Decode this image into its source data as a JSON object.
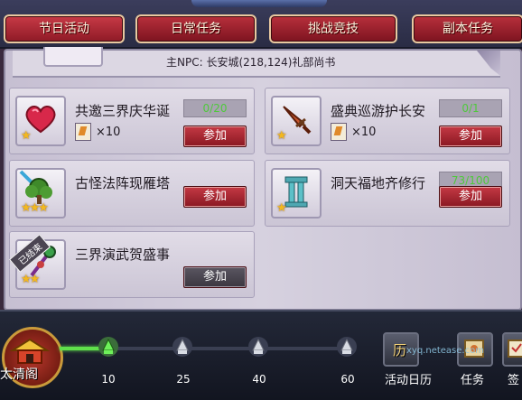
{
  "tabs": [
    {
      "label": "节日活动"
    },
    {
      "label": "日常任务"
    },
    {
      "label": "挑战竞技"
    },
    {
      "label": "副本任务"
    }
  ],
  "npc_line": "主NPC: 长安城(218,124)礼部尚书",
  "activities": [
    {
      "title": "共邀三界庆华诞",
      "progress": "0/20",
      "reward_count": "×10",
      "join": "参加",
      "stars": "★",
      "icon": "heart-icon"
    },
    {
      "title": "盛典巡游护长安",
      "progress": "0/1",
      "reward_count": "×10",
      "join": "参加",
      "stars": "★",
      "icon": "sword-icon"
    },
    {
      "title": "古怪法阵现雁塔",
      "join": "参加",
      "stars": "★★★",
      "icon": "tree-icon"
    },
    {
      "title": "洞天福地齐修行",
      "progress": "73/100",
      "join": "参加",
      "stars": "★",
      "icon": "pillar-icon"
    },
    {
      "title": "三界演武贺盛事",
      "join": "参加",
      "stars": "★★",
      "ended": "已结束",
      "icon": "staff-icon"
    }
  ],
  "bottom": {
    "emblem_label": "太清阁",
    "milestones": [
      "10",
      "25",
      "40",
      "60"
    ],
    "nav": [
      {
        "label": "活动日历",
        "icon_text": "历"
      },
      {
        "label": "任务"
      },
      {
        "label": "签"
      }
    ],
    "watermark": "xyq.netease.com"
  },
  "colors": {
    "tab_red": "#b8303c",
    "progress_green": "#4fc93c",
    "track_green": "#5fe04b"
  }
}
